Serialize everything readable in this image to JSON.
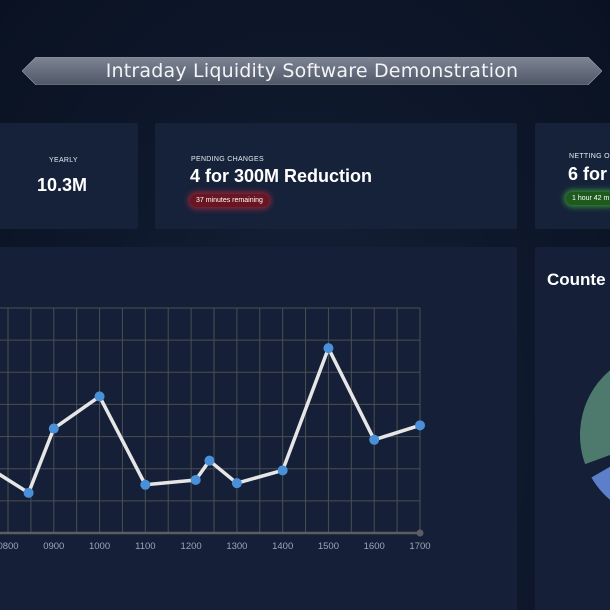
{
  "header": {
    "title": "Intraday Liquidity Software Demonstration"
  },
  "kpis": {
    "yearly": {
      "label": "YEARLY",
      "value": "10.3M"
    },
    "pending": {
      "label": "PENDING CHANGES",
      "value": "4 for 300M Reduction",
      "status": "37 minutes remaining",
      "status_color": "#d8283c"
    },
    "netting": {
      "label": "NETTING O",
      "value": "6 for",
      "status": "1 hour 42 m",
      "status_color": "#46c83c"
    }
  },
  "pie": {
    "title": "Counte",
    "colors": [
      "#5b7fc8",
      "#8a2e24",
      "#b9b27a",
      "#4e7a6e"
    ]
  },
  "colors": {
    "background": "#0c1526",
    "card": "#16223a",
    "line": "#e6e6e6",
    "marker": "#4a90d9",
    "grid": "#4a4e52"
  },
  "chart_data": {
    "type": "line",
    "x_tick_labels": [
      "0800",
      "0900",
      "1000",
      "1100",
      "1200",
      "1300",
      "1400",
      "1500",
      "1600",
      "1700"
    ],
    "x": [
      745,
      845,
      900,
      1000,
      1100,
      1210,
      1240,
      1300,
      1400,
      1500,
      1600,
      1700
    ],
    "y": [
      4.3,
      2.5,
      6.5,
      8.5,
      3.0,
      3.3,
      4.5,
      3.1,
      3.9,
      11.5,
      5.8,
      6.7
    ],
    "ylim": [
      0,
      14
    ],
    "grid": true,
    "xlabel": "",
    "ylabel": ""
  }
}
